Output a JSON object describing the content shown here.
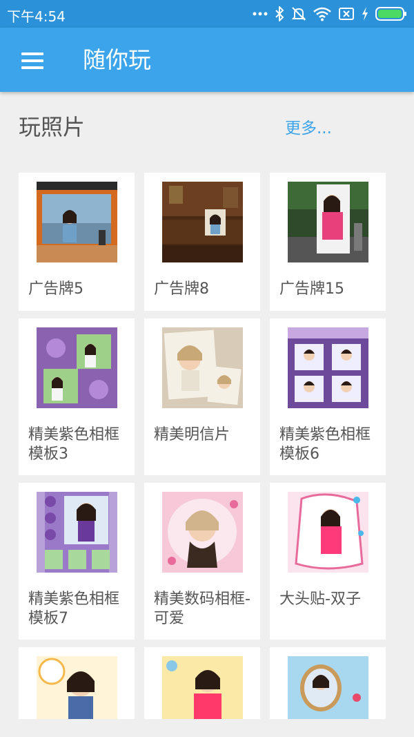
{
  "status_bar": {
    "time": "下午4:54",
    "icons": [
      "more-dots-icon",
      "bluetooth-icon",
      "bell-muted-icon",
      "wifi-icon",
      "sim-x-icon",
      "charging-icon",
      "battery-icon"
    ]
  },
  "app_bar": {
    "title": "随你玩",
    "menu_icon": "hamburger-icon"
  },
  "section": {
    "title": "玩照片",
    "more": "更多..."
  },
  "items": [
    {
      "label": "广告牌5"
    },
    {
      "label": "广告牌8"
    },
    {
      "label": "广告牌15"
    },
    {
      "label": "精美紫色相框模板3"
    },
    {
      "label": "精美明信片"
    },
    {
      "label": "精美紫色相框模板6"
    },
    {
      "label": "精美紫色相框模板7"
    },
    {
      "label": "精美数码相框-可爱"
    },
    {
      "label": "大头贴-双子"
    },
    {
      "label": ""
    },
    {
      "label": ""
    },
    {
      "label": ""
    }
  ],
  "colors": {
    "status_bar": "#2b92d9",
    "app_bar": "#3ba4ea",
    "accent": "#3ba4ea",
    "background": "#efefef",
    "battery": "#4cd964"
  }
}
